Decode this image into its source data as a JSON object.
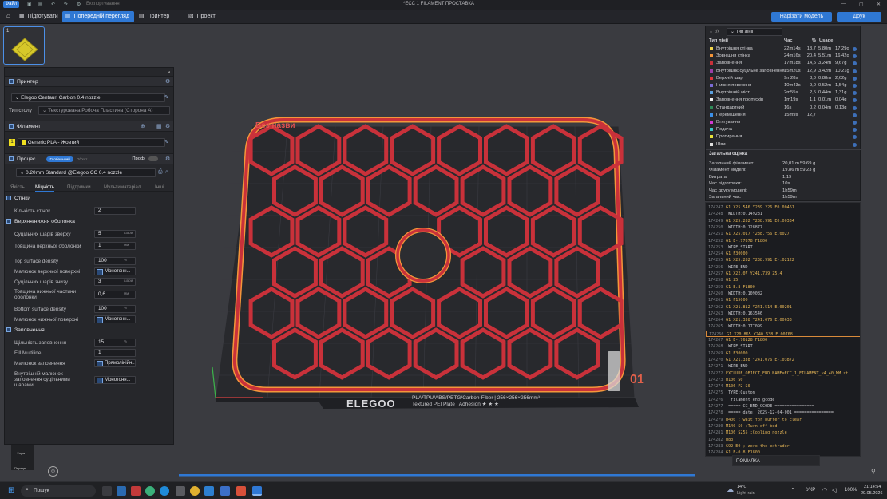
{
  "titlebar": {
    "file_menu": "Файл",
    "hint": "Експортування",
    "title": "*ЕСС 1 FILAMENT ПРОСТАВКА"
  },
  "tabs": [
    {
      "label": "Підготувати"
    },
    {
      "label": "Попередній перегляд"
    },
    {
      "label": "Принтер"
    },
    {
      "label": "Проект"
    }
  ],
  "toolbar": {
    "slice_label": "Нарізати модель",
    "print_label": "Друк"
  },
  "printer": {
    "section": "Принтер",
    "name": "Elegoo Centauri Carbon 0.4 nozzle",
    "bed_label": "Тип столу",
    "bed_value": "Текстурована Робоча Пластина (Сторона А)"
  },
  "filament": {
    "section": "Філамент",
    "slot": "1",
    "name": "Generic PLA - Жовтий"
  },
  "process": {
    "section": "Процес",
    "toggle_global": "Глобальний",
    "toggle_object": "Об'єкт",
    "pro_label": "Профі",
    "profile": "0.20mm Standard @Elegoo CC 0.4 nozzle",
    "subtabs": [
      "Якість",
      "Міцність",
      "Підтримки",
      "Мультиматеріал",
      "Інші"
    ]
  },
  "walls": {
    "section": "Стінки",
    "loops_label": "Кількість стінок",
    "loops_value": "2"
  },
  "shells": {
    "section": "Верхня/нижня оболонка",
    "rows": [
      {
        "label": "Суцільних шарів зверху",
        "value": "5",
        "unit": "шари"
      },
      {
        "label": "Товщина верхньої оболонки",
        "value": "1",
        "unit": "мм"
      },
      {
        "label": "Top surface density",
        "value": "100",
        "unit": "%"
      },
      {
        "label": "Малюнок верхньої поверхні",
        "value": "Монотонн..."
      },
      {
        "label": "Суцільних шарів знизу",
        "value": "3",
        "unit": "шари"
      },
      {
        "label": "Товщина нижньої частини оболонки",
        "value": "0,6",
        "unit": "мм"
      },
      {
        "label": "Bottom surface density",
        "value": "100",
        "unit": "%"
      },
      {
        "label": "Малюнок нижньої поверхні",
        "value": "Монотонн..."
      }
    ]
  },
  "infill": {
    "section": "Заповнення",
    "rows": [
      {
        "label": "Щільність заповнення",
        "value": "15",
        "unit": "%"
      },
      {
        "label": "Fill Multiline",
        "value": "1"
      },
      {
        "label": "Малюнок заповнення",
        "value": "Прямолінійн..."
      },
      {
        "label": "Внутрішній малюнок заповнення суцільними шарами",
        "value": "Монотонн..."
      }
    ]
  },
  "bottom_left": {
    "label1": "Форм",
    "label2": "Передп"
  },
  "viewport": {
    "model_name": "Без назви",
    "plate_number": "01",
    "plate_brand": "ELEGOO",
    "plate_line1": "PLA/TPU/ABS/PETG/Carbon-Fiber | 256×256×256mm³",
    "plate_line2": "Textured PEI Plate | Adhesion ★ ★ ★"
  },
  "legend": {
    "dropdown": "Тип лінії",
    "headers": {
      "type": "Тип лінії",
      "time": "Час",
      "pct": "%",
      "usage": "Usage"
    },
    "rows": [
      {
        "name": "Внутрішня стінка",
        "time": "22m14s",
        "pct": "18,7",
        "u1": "5,80m",
        "u2": "17,29g",
        "color": "#f2d64a"
      },
      {
        "name": "Зовнішня стінка",
        "time": "24m16s",
        "pct": "20,4",
        "u1": "5,51m",
        "u2": "16,42g",
        "color": "#f4963a"
      },
      {
        "name": "Заповнення",
        "time": "17m18s",
        "pct": "14,5",
        "u1": "3,24m",
        "u2": "9,67g",
        "color": "#c9313a"
      },
      {
        "name": "Внутрішнє суцільне заповнення",
        "time": "15m20s",
        "pct": "12,9",
        "u1": "3,42m",
        "u2": "10,21g",
        "color": "#9b3fa8"
      },
      {
        "name": "Верхній шар",
        "time": "9m28s",
        "pct": "8,0",
        "u1": "0,88m",
        "u2": "2,62g",
        "color": "#e2343c"
      },
      {
        "name": "Нижня поверхня",
        "time": "10m43s",
        "pct": "9,0",
        "u1": "0,52m",
        "u2": "1,54g",
        "color": "#7a6bd6"
      },
      {
        "name": "Внутрішній міст",
        "time": "2m55s",
        "pct": "2,5",
        "u1": "0,44m",
        "u2": "1,31g",
        "color": "#5aa0e0"
      },
      {
        "name": "Заповнення пропусків",
        "time": "1m19s",
        "pct": "1,1",
        "u1": "0,01m",
        "u2": "0,04g",
        "color": "#f0f0f0"
      },
      {
        "name": "Стандартний",
        "time": "16s",
        "pct": "0,2",
        "u1": "0,04m",
        "u2": "0,13g",
        "color": "#2e8b57"
      },
      {
        "name": "Переміщення",
        "time": "15m9s",
        "pct": "12,7",
        "u1": "",
        "u2": "",
        "color": "#3b8fe8"
      },
      {
        "name": "Втягування",
        "time": "",
        "pct": "",
        "u1": "",
        "u2": "",
        "color": "#d23ad2"
      },
      {
        "name": "Подача",
        "time": "",
        "pct": "",
        "u1": "",
        "u2": "",
        "color": "#3cc8c8"
      },
      {
        "name": "Протирання",
        "time": "",
        "pct": "",
        "u1": "",
        "u2": "",
        "color": "#e8e23a"
      },
      {
        "name": "Шви",
        "time": "",
        "pct": "",
        "u1": "",
        "u2": "",
        "color": "#e0e0e0"
      }
    ],
    "summary_title": "Загальна оцінка",
    "summary": [
      {
        "k": "Загальний філамент:",
        "v1": "20,01 m",
        "v2": "59,69 g"
      },
      {
        "k": "Філамент моделі:",
        "v1": "19.86 m",
        "v2": "59,23 g"
      },
      {
        "k": "Витрата:",
        "v1": "1,19",
        "v2": ""
      },
      {
        "k": "Час підготовки:",
        "v1": "10s",
        "v2": ""
      },
      {
        "k": "Час друку моделі:",
        "v1": "1h59m",
        "v2": ""
      },
      {
        "k": "Загальний час:",
        "v1": "1h59m",
        "v2": ""
      }
    ]
  },
  "gcode": [
    {
      "n": "174247",
      "c": "G1 X25.546 Y239.226 E0.00461"
    },
    {
      "n": "174248",
      "c": ";WIDTH:0.149231"
    },
    {
      "n": "174249",
      "c": "G1 X25.282 Y238.991 E0.00334"
    },
    {
      "n": "174250",
      "c": ";WIDTH:0.128877"
    },
    {
      "n": "174251",
      "c": "G1 X25.017 Y238.756 E.0027"
    },
    {
      "n": "174252",
      "c": "G1 E-.77878 F1800"
    },
    {
      "n": "174253",
      "c": ";WIPE_START"
    },
    {
      "n": "174254",
      "c": "G1 F30000"
    },
    {
      "n": "174255",
      "c": "G1 X25.282 Y238.991 E-.02122"
    },
    {
      "n": "174256",
      "c": ";WIPE_END"
    },
    {
      "n": "174257",
      "c": "G1 X22.07 Y241.739 Z5.4"
    },
    {
      "n": "174258",
      "c": "G1 Z5"
    },
    {
      "n": "174259",
      "c": "G1 E.8 F1800"
    },
    {
      "n": "174260",
      "c": ";WIDTH:0.109082"
    },
    {
      "n": "174261",
      "c": "G1 F15000"
    },
    {
      "n": "174262",
      "c": "G1 X21.812 Y241.514 E.00201"
    },
    {
      "n": "174263",
      "c": ";WIDTH:0.163546"
    },
    {
      "n": "174264",
      "c": "G1 X21.338 Y241.076 E.00633"
    },
    {
      "n": "174265",
      "c": ";WIDTH:0.177099"
    },
    {
      "n": "174266",
      "c": "G1 X20.865 Y240.638 E.00768"
    },
    {
      "n": "174267",
      "c": "G1 E-.76128 F1800"
    },
    {
      "n": "174268",
      "c": ";WIPE_START"
    },
    {
      "n": "174269",
      "c": "G1 F30000"
    },
    {
      "n": "174270",
      "c": "G1 X21.338 Y241.076 E-.03872"
    },
    {
      "n": "174271",
      "c": ";WIPE_END"
    },
    {
      "n": "174272",
      "c": "EXCLUDE_OBJECT_END NAME=ECC_1_FILAMENT_v4_40_MM.st..."
    },
    {
      "n": "174273",
      "c": "M106 S0"
    },
    {
      "n": "174274",
      "c": "M106 P2 S0"
    },
    {
      "n": "174275",
      "c": ";TYPE:Custom"
    },
    {
      "n": "174276",
      "c": "; filament end gcode"
    },
    {
      "n": "174277",
      "c": ";===== CC_END_GCODE ================"
    },
    {
      "n": "174278",
      "c": ";===== date: 2025-12-04-001 ================"
    },
    {
      "n": "174279",
      "c": "M400 ; wait for buffer to clear"
    },
    {
      "n": "174280",
      "c": "M140 S0 ;Turn-off bed"
    },
    {
      "n": "174281",
      "c": "M106 S255 ;Cooling nozzle"
    },
    {
      "n": "174282",
      "c": "M83"
    },
    {
      "n": "174283",
      "c": "G92 E0 ; zero the extruder"
    },
    {
      "n": "174284",
      "c": "G1 E-0.8 F1800"
    }
  ],
  "notice": "ПОМИЛКА",
  "taskbar": {
    "search": "Пошук",
    "weather_temp": "14°C",
    "weather_text": "Light rain",
    "lang": "УКР",
    "battery": "100%",
    "time": "21:14:54",
    "date": "29.05.2026"
  },
  "colors": {
    "accent": "#2f78d4",
    "model_red": "#c9313a",
    "outer_wall": "#f4963a"
  }
}
